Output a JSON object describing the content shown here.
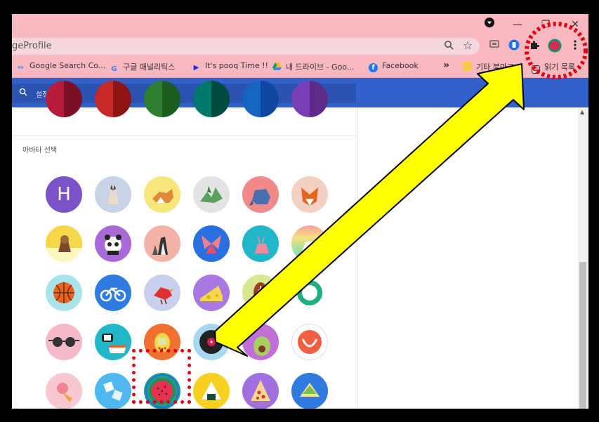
{
  "window": {
    "controls": [
      "—",
      "❐",
      "✕"
    ]
  },
  "toolbar": {
    "url_text": "geProfile",
    "icons": [
      "magnify-icon",
      "star-icon",
      "cast-icon",
      "extension-blue-icon",
      "puzzle-icon",
      "profile-avatar-icon",
      "menu-icon"
    ]
  },
  "bookmarks": {
    "items": [
      {
        "label": "Google Search Co...",
        "icon": "google-search-console-icon"
      },
      {
        "label": "구글 애널리틱스",
        "icon": "google-g-icon"
      },
      {
        "label": "It's pooq Time !!",
        "icon": "pooq-play-icon"
      },
      {
        "label": "내 드라이브 - Goo...",
        "icon": "google-drive-icon"
      },
      {
        "label": "Facebook",
        "icon": "facebook-icon"
      }
    ],
    "overflow": "»",
    "other_bookmarks": "기타 북마크",
    "reading_list": "읽기 목록"
  },
  "settings": {
    "search_placeholder": "설정 검색",
    "avatar_section_label": "아바타 선택",
    "first_avatar_letter": "H"
  },
  "colors": {
    "chrome_theme": "#f9b7c0",
    "header_blue": "#3060c8",
    "highlight_red": "#e00010",
    "arrow_yellow": "#ffff00"
  }
}
